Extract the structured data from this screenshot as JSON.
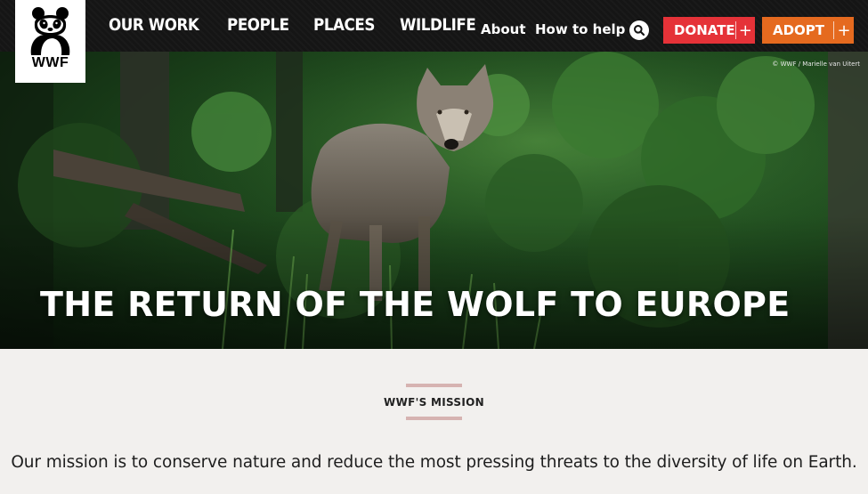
{
  "logo": {
    "text": "WWF",
    "icon": "panda-icon"
  },
  "nav": {
    "main": [
      "OUR WORK",
      "PEOPLE",
      "PLACES",
      "WILDLIFE"
    ],
    "about": "About",
    "how_to_help": "How to help",
    "search_icon": "search-icon"
  },
  "cta": {
    "donate": {
      "label": "DONATE",
      "plus": "+"
    },
    "adopt": {
      "label": "ADOPT",
      "plus": "+"
    }
  },
  "hero": {
    "credit": "© WWF / Marielle van Uitert",
    "title": "THE RETURN OF THE WOLF TO EUROPE"
  },
  "mission": {
    "label": "WWF'S MISSION",
    "text": "Our mission is to conserve nature and reduce the most pressing threats to the diversity of life on Earth."
  },
  "colors": {
    "header_bg": "#151515",
    "donate": "#e53238",
    "adopt": "#e56a1f",
    "mission_accent": "#d6b3b1",
    "page_bg": "#f2f0ee"
  }
}
